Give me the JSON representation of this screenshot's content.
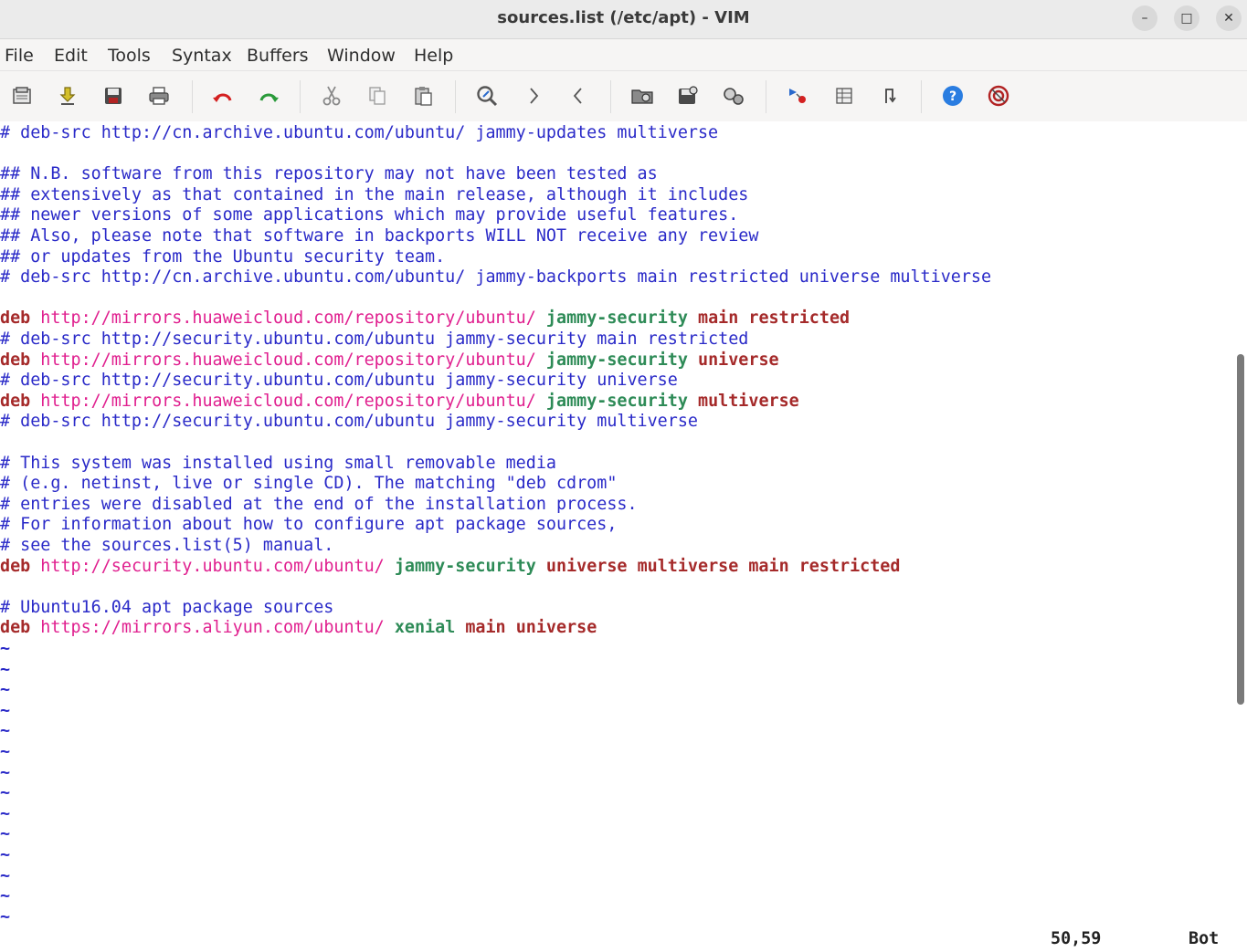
{
  "window": {
    "title": "sources.list (/etc/apt) - VIM",
    "minimize_glyph": "–",
    "maximize_glyph": "□",
    "close_glyph": "✕"
  },
  "menu": [
    "File",
    "Edit",
    "Tools",
    "Syntax",
    "Buffers",
    "Window",
    "Help"
  ],
  "toolbar_icons": [
    "open-file-icon",
    "save-download-icon",
    "save-icon",
    "print-icon",
    "undo-icon",
    "redo-icon",
    "cut-icon",
    "copy-icon",
    "paste-icon",
    "find-replace-icon",
    "find-next-icon",
    "find-previous-icon",
    "load-session-icon",
    "save-session-icon",
    "run-script-icon",
    "make-icon",
    "run-ctags-icon",
    "jump-to-tag-icon",
    "help-icon",
    "find-help-icon"
  ],
  "editor": {
    "lines": [
      [
        {
          "text": "# deb-src http://cn.archive.ubuntu.com/ubuntu/ jammy-updates multiverse",
          "cls": "c"
        }
      ],
      [],
      [
        {
          "text": "## N.B. software from this repository may not have been tested as",
          "cls": "c"
        }
      ],
      [
        {
          "text": "## extensively as that contained in the main release, although it includes",
          "cls": "c"
        }
      ],
      [
        {
          "text": "## newer versions of some applications which may provide useful features.",
          "cls": "c"
        }
      ],
      [
        {
          "text": "## Also, please note that software in backports WILL NOT receive any review",
          "cls": "c"
        }
      ],
      [
        {
          "text": "## or updates from the Ubuntu security team.",
          "cls": "c"
        }
      ],
      [
        {
          "text": "# deb-src http://cn.archive.ubuntu.com/ubuntu/ jammy-backports main restricted universe multiverse",
          "cls": "c"
        }
      ],
      [],
      [
        {
          "text": "deb",
          "cls": "k"
        },
        {
          "text": " "
        },
        {
          "text": "http://mirrors.huaweicloud.com/repository/ubuntu/",
          "cls": "u"
        },
        {
          "text": " "
        },
        {
          "text": "jammy-security",
          "cls": "s"
        },
        {
          "text": " "
        },
        {
          "text": "main restricted",
          "cls": "k"
        }
      ],
      [
        {
          "text": "# deb-src http://security.ubuntu.com/ubuntu jammy-security main restricted",
          "cls": "c"
        }
      ],
      [
        {
          "text": "deb",
          "cls": "k"
        },
        {
          "text": " "
        },
        {
          "text": "http://mirrors.huaweicloud.com/repository/ubuntu/",
          "cls": "u"
        },
        {
          "text": " "
        },
        {
          "text": "jammy-security",
          "cls": "s"
        },
        {
          "text": " "
        },
        {
          "text": "universe",
          "cls": "k"
        }
      ],
      [
        {
          "text": "# deb-src http://security.ubuntu.com/ubuntu jammy-security universe",
          "cls": "c"
        }
      ],
      [
        {
          "text": "deb",
          "cls": "k"
        },
        {
          "text": " "
        },
        {
          "text": "http://mirrors.huaweicloud.com/repository/ubuntu/",
          "cls": "u"
        },
        {
          "text": " "
        },
        {
          "text": "jammy-security",
          "cls": "s"
        },
        {
          "text": " "
        },
        {
          "text": "multiverse",
          "cls": "k"
        }
      ],
      [
        {
          "text": "# deb-src http://security.ubuntu.com/ubuntu jammy-security multiverse",
          "cls": "c"
        }
      ],
      [],
      [
        {
          "text": "# This system was installed using small removable media",
          "cls": "c"
        }
      ],
      [
        {
          "text": "# (e.g. netinst, live or single CD). The matching \"deb cdrom\"",
          "cls": "c"
        }
      ],
      [
        {
          "text": "# entries were disabled at the end of the installation process.",
          "cls": "c"
        }
      ],
      [
        {
          "text": "# For information about how to configure apt package sources,",
          "cls": "c"
        }
      ],
      [
        {
          "text": "# see the sources.list(5) manual.",
          "cls": "c"
        }
      ],
      [
        {
          "text": "deb",
          "cls": "k"
        },
        {
          "text": " "
        },
        {
          "text": "http://security.ubuntu.com/ubuntu/",
          "cls": "u"
        },
        {
          "text": " "
        },
        {
          "text": "jammy-security",
          "cls": "s"
        },
        {
          "text": " "
        },
        {
          "text": "universe multiverse main restricted",
          "cls": "k"
        }
      ],
      [],
      [
        {
          "text": "# Ubuntu16.04 apt package sources",
          "cls": "c"
        }
      ],
      [
        {
          "text": "deb",
          "cls": "k"
        },
        {
          "text": " "
        },
        {
          "text": "https://mirrors.aliyun.com/ubuntu/",
          "cls": "u"
        },
        {
          "text": " "
        },
        {
          "text": "xenial",
          "cls": "s"
        },
        {
          "text": " "
        },
        {
          "text": "main universe",
          "cls": "k"
        }
      ]
    ],
    "tilde": "~",
    "tilde_count": 14
  },
  "status": {
    "position": "50,59",
    "scroll": "Bot"
  },
  "colors": {
    "comment": "#2a2ac8",
    "keyword": "#a52a2a",
    "url": "#e0208f",
    "suite": "#2e8b57"
  }
}
